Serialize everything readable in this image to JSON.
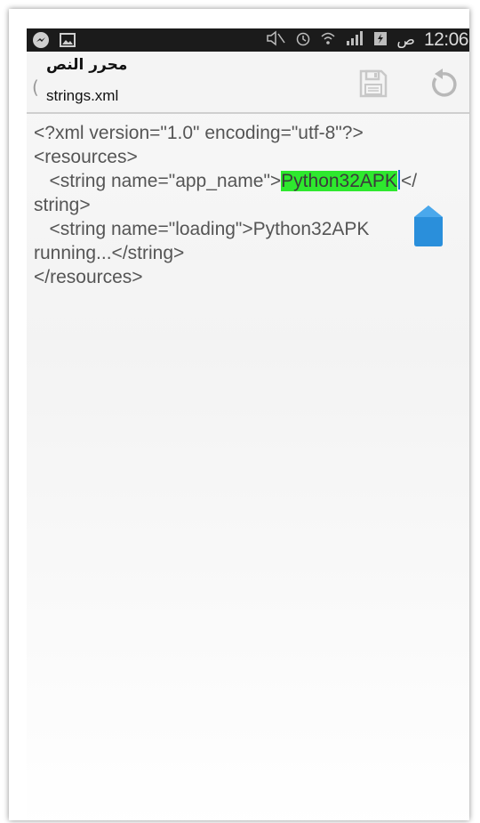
{
  "status_bar": {
    "time": "12:06",
    "ampm": "ص",
    "icons": [
      "messenger-icon",
      "gallery-icon",
      "mute-icon",
      "alarm-icon",
      "wifi-icon",
      "signal-icon",
      "battery-icon"
    ]
  },
  "action_bar": {
    "app_title": "محرر النص",
    "file_name": "strings.xml",
    "save_icon": "save-icon",
    "revert_icon": "revert-icon"
  },
  "editor": {
    "line1": "<?xml version=\"1.0\" encoding=\"utf-8\"?>",
    "line2": "<resources>",
    "line3_before": "   <string name=\"app_name\">",
    "line3_selected": "Python32APK",
    "line3_after": "</",
    "line4": "string>",
    "line5": "   <string name=\"loading\">Python32APK",
    "line6": "running...</string>",
    "line7": "</resources>"
  },
  "colors": {
    "selection": "#2ee82e",
    "caret": "#1a6fd6",
    "handle": "#2a8fdb",
    "status_bar": "#1b1b1b"
  }
}
